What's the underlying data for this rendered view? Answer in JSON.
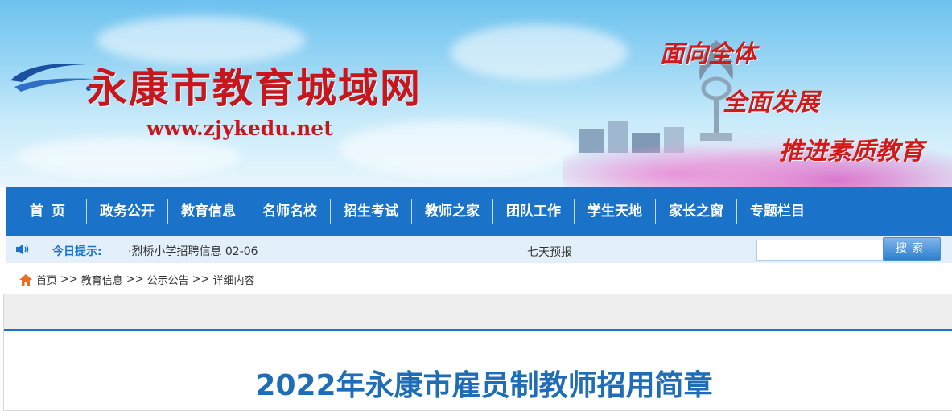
{
  "header": {
    "site_title": "永康市教育城域网",
    "site_url": "www.zjykedu.net",
    "slogans": [
      "面向全体",
      "全面发展",
      "推进素质教育"
    ]
  },
  "nav": {
    "items": [
      "首页",
      "政务公开",
      "教育信息",
      "名师名校",
      "招生考试",
      "教师之家",
      "团队工作",
      "学生天地",
      "家长之窗",
      "专题栏目"
    ]
  },
  "notice": {
    "label": "今日提示:",
    "text": "·烈桥小学招聘信息 02-06",
    "weather": "七天预报"
  },
  "search": {
    "button_label": "搜索",
    "value": ""
  },
  "breadcrumb": {
    "items": [
      "首页",
      ">>",
      "教育信息",
      ">>",
      "公示公告",
      ">>",
      "详细内容"
    ]
  },
  "article": {
    "title": "2022年永康市雇员制教师招用简章"
  },
  "colors": {
    "nav_bg": "#1b73c9",
    "title_red": "#c8161d",
    "article_title_blue": "#1e6db6"
  }
}
